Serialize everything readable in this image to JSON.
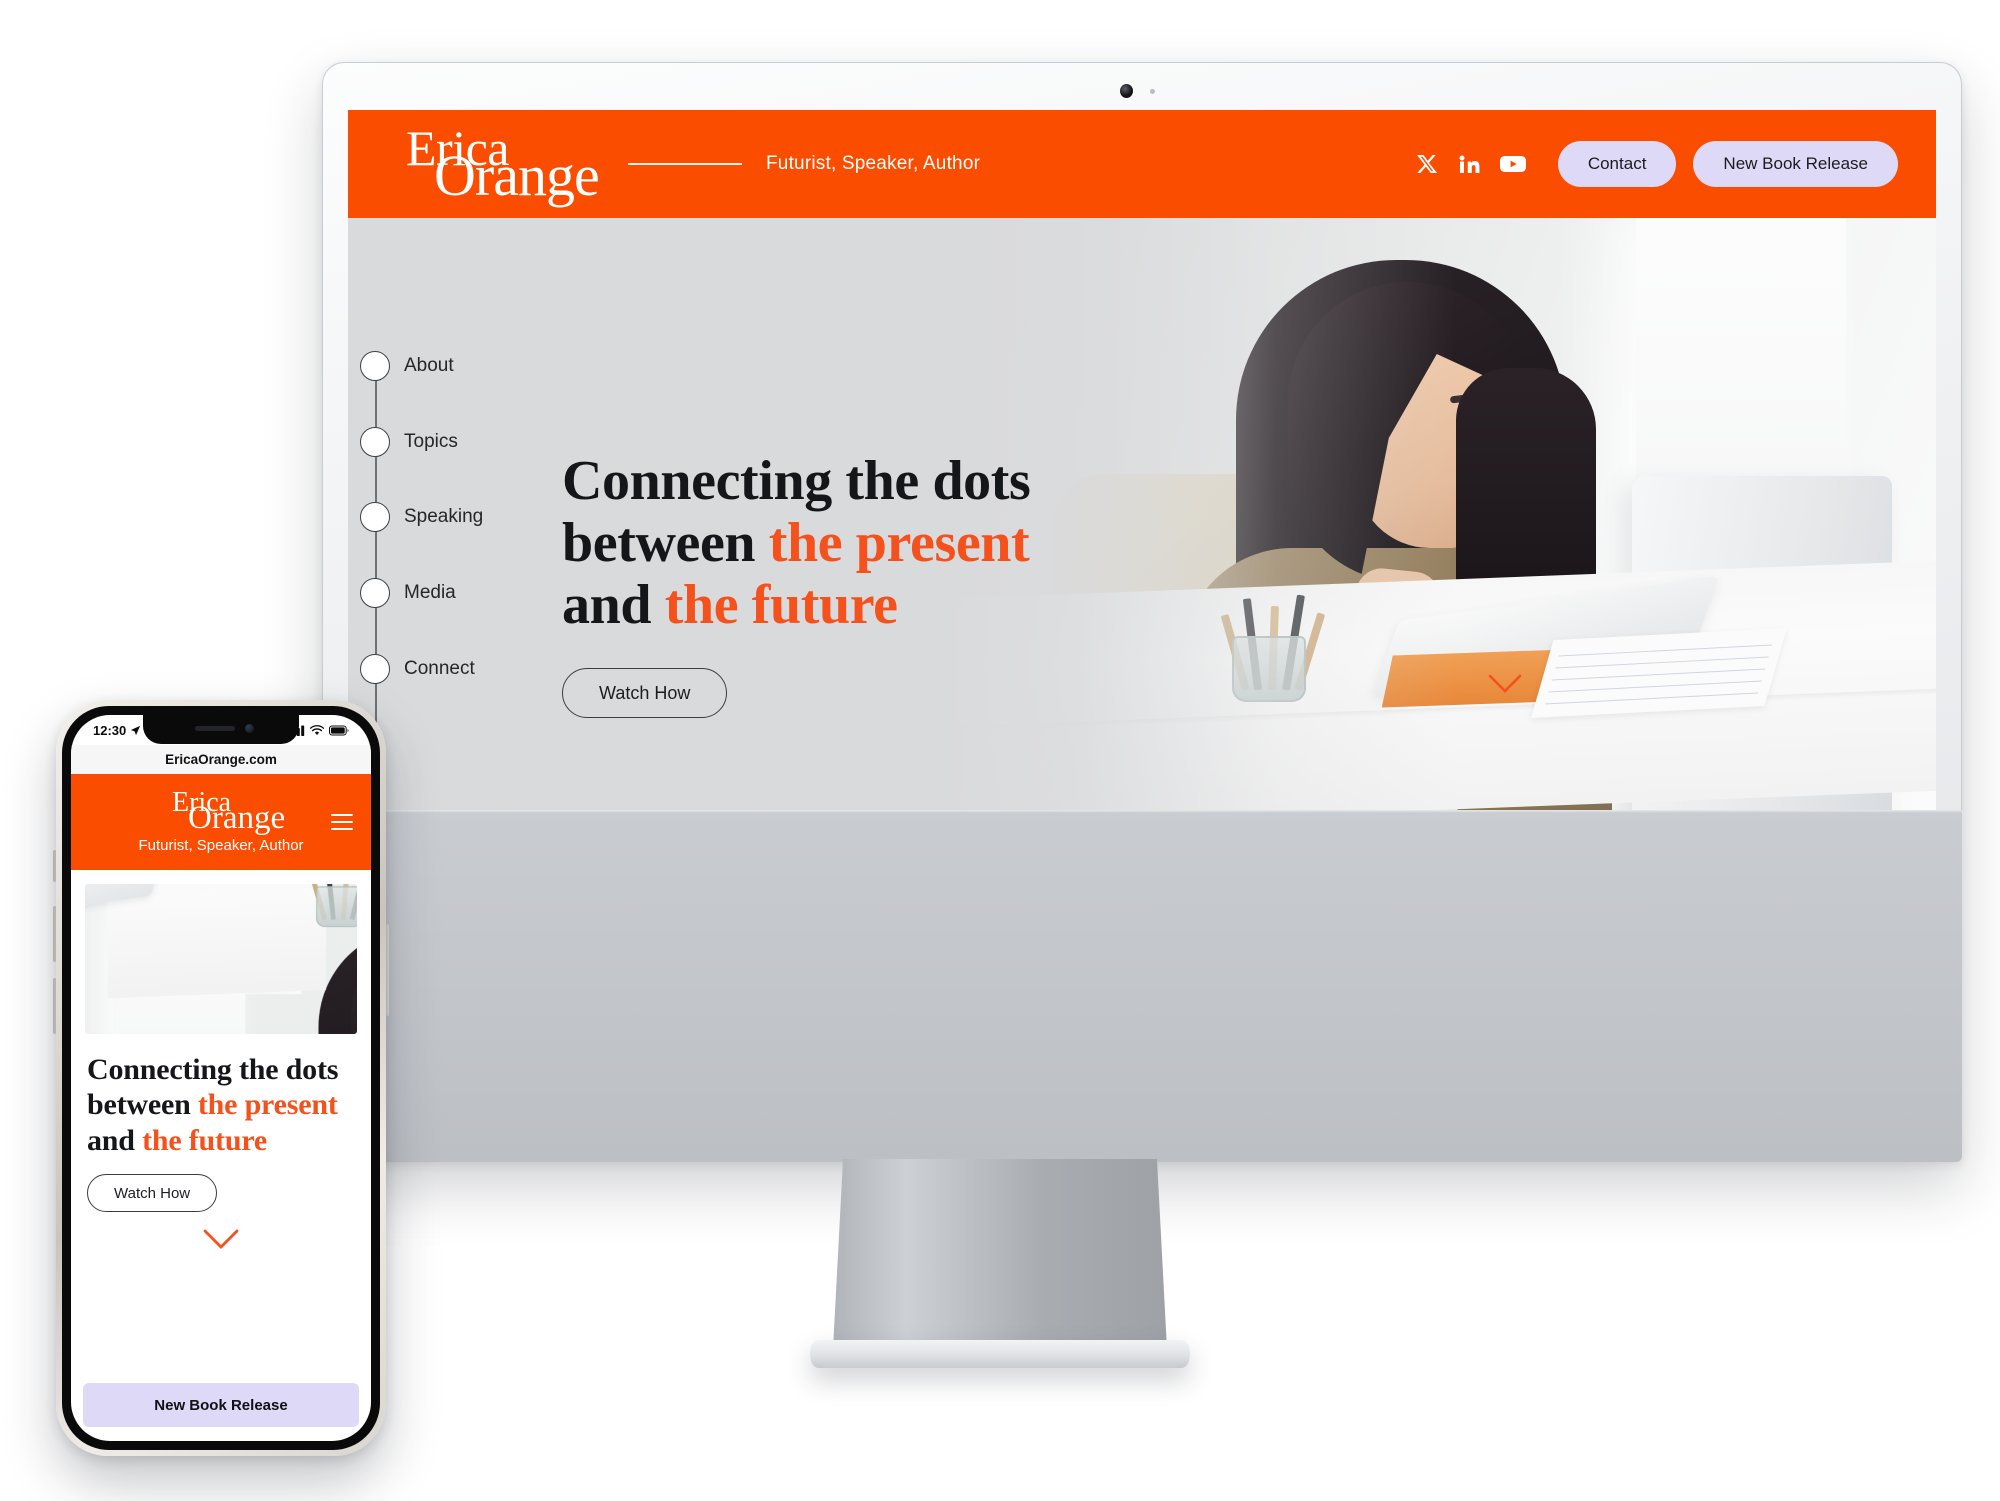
{
  "brand": {
    "logo_line1": "Erica",
    "logo_line2": "Orange",
    "tagline": "Futurist, Speaker, Author",
    "orange": "#FA4D00",
    "accent_text": "#F4511C",
    "lavender": "#DED9F7",
    "screen_bg": "#D9DADC"
  },
  "header": {
    "social": [
      {
        "name": "x-twitter-icon",
        "label": "X"
      },
      {
        "name": "linkedin-icon",
        "label": "LinkedIn"
      },
      {
        "name": "youtube-icon",
        "label": "YouTube"
      }
    ],
    "contact_label": "Contact",
    "book_label": "New Book Release"
  },
  "nav": {
    "items": [
      {
        "label": "About"
      },
      {
        "label": "Topics"
      },
      {
        "label": "Speaking"
      },
      {
        "label": "Media"
      },
      {
        "label": "Connect"
      }
    ]
  },
  "hero": {
    "headline_part1": "Connecting the dots",
    "headline_part2": "between ",
    "headline_accent1": "the present",
    "headline_part3": "and ",
    "headline_accent2": "the future",
    "watch_label": "Watch How",
    "scroll_hint": "chevron-down-icon"
  },
  "phone": {
    "status_time": "12:30",
    "status_icons": [
      "location-arrow-icon",
      "cellular-signal-icon",
      "wifi-icon",
      "battery-icon"
    ],
    "url": "EricaOrange.com",
    "logo_line1": "Erica",
    "logo_line2": "Orange",
    "tagline": "Futurist, Speaker, Author",
    "menu_icon": "hamburger-menu-icon",
    "headline_part1": "Connecting the dots",
    "headline_part2": "between ",
    "headline_accent1": "the present",
    "headline_part3": "and ",
    "headline_accent2": "the future",
    "watch_label": "Watch How",
    "cta_label": "New Book Release"
  },
  "device": {
    "camera": "webcam-dot",
    "indicator": "status-indicator-dot"
  }
}
